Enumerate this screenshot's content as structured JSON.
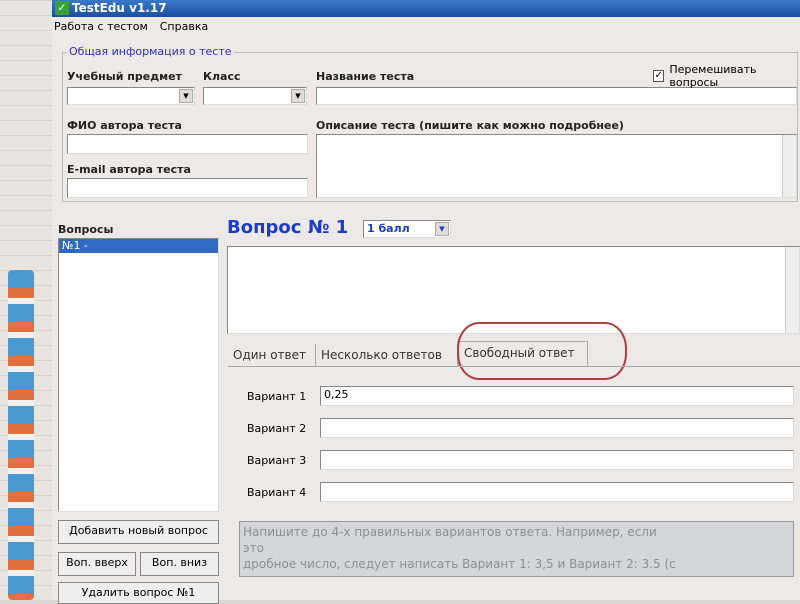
{
  "window": {
    "title": "TestEdu v1.17"
  },
  "menu": [
    "Работа с тестом",
    "Справка"
  ],
  "info": {
    "legend": "Общая информация о тесте",
    "subject_label": "Учебный предмет",
    "class_label": "Класс",
    "name_label": "Название теста",
    "shuffle_label": "Перемешивать вопросы",
    "author_label": "ФИО автора теста",
    "desc_label": "Описание теста (пишите как можно подробнее)",
    "email_label": "E-mail автора теста"
  },
  "questions": {
    "label": "Вопросы",
    "items": [
      "№1 -"
    ],
    "add": "Добавить новый вопрос",
    "up": "Воп. вверх",
    "down": "Воп. вниз",
    "delete": "Удалить вопрос №1"
  },
  "question": {
    "title": "Вопрос № 1",
    "points": "1 балл"
  },
  "tabs": [
    "Один ответ",
    "Несколько ответов",
    "Свободный ответ"
  ],
  "variants": [
    {
      "label": "Вариант 1",
      "value": "0,25"
    },
    {
      "label": "Вариант 2",
      "value": ""
    },
    {
      "label": "Вариант 3",
      "value": ""
    },
    {
      "label": "Вариант 4",
      "value": ""
    }
  ],
  "hint": [
    "Напишите до 4-х правильных вариантов ответа. Например, если",
    "это",
    "дробное число, следует написать Вариант 1: 3,5 и Вариант 2: 3.5 (с"
  ]
}
